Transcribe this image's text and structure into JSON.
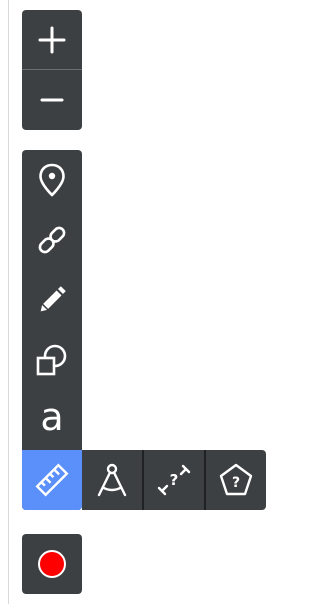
{
  "toolbar": {
    "zoom": {
      "zoom_in": {
        "icon": "plus-icon"
      },
      "zoom_out": {
        "icon": "minus-icon"
      }
    },
    "tools": [
      {
        "id": "marker",
        "icon": "map-pin-icon"
      },
      {
        "id": "link",
        "icon": "link-icon"
      },
      {
        "id": "draw",
        "icon": "pencil-icon"
      },
      {
        "id": "shapes",
        "icon": "shapes-icon"
      },
      {
        "id": "text",
        "icon": "text-icon",
        "glyph": "a"
      },
      {
        "id": "measure",
        "icon": "ruler-icon",
        "active": true
      }
    ],
    "measure_options": [
      {
        "id": "compass",
        "icon": "compass-icon"
      },
      {
        "id": "distance",
        "icon": "distance-icon"
      },
      {
        "id": "area",
        "icon": "polygon-question-icon"
      }
    ],
    "record": {
      "icon": "record-icon"
    }
  },
  "colors": {
    "panel_bg": "#3d4043",
    "active_bg": "#5b8ff9",
    "icon_fg": "#ffffff",
    "record_red": "#ff0000"
  }
}
